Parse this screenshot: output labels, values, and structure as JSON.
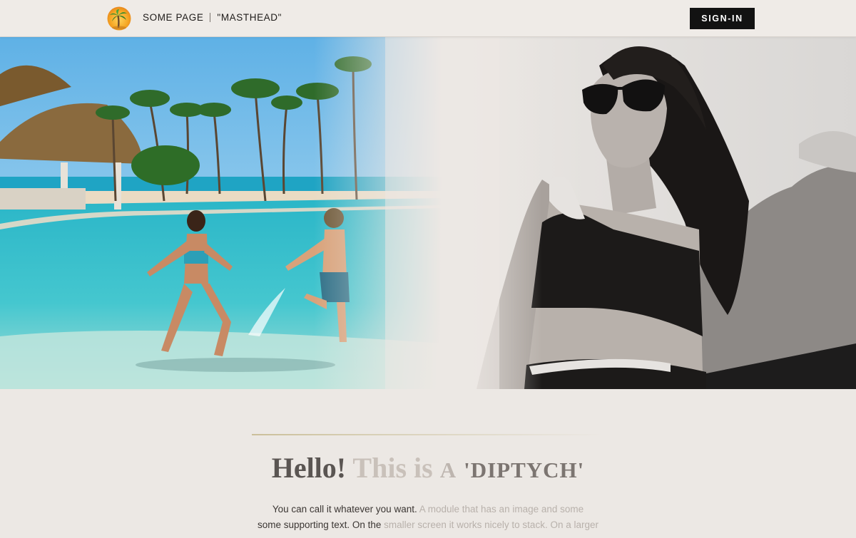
{
  "header": {
    "brand_name": "SOME PAGE",
    "brand_tagline": "\"MASTHEAD\"",
    "signin_label": "SIGN-IN",
    "logo_icon": "palm-tree-sunset-icon"
  },
  "hero": {
    "left_image": "beach-resort-pool-kids-photo",
    "right_image": "woman-sunglasses-swimsuit-bw-photo"
  },
  "content": {
    "heading_part1": "Hello!",
    "heading_part2": "This is",
    "heading_part3": "A",
    "heading_part4": "'DIPTYCH'",
    "body_line1_a": "You can call it whatever you want.",
    "body_line1_b": "A module that has an image and some",
    "body_line2_a": "some supporting text. On the",
    "body_line2_b": "smaller screen it works nicely to stack. On a larger screen,"
  },
  "colors": {
    "page_bg": "#ece8e4",
    "header_bg": "#efebe7",
    "button_bg": "#121212",
    "accent_line": "#cbbf9a"
  }
}
